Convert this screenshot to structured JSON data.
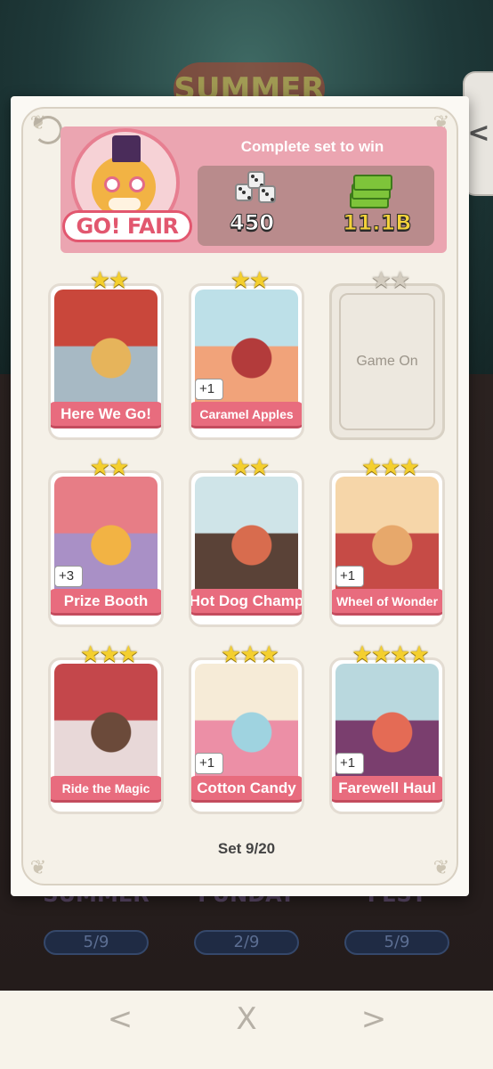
{
  "background": {
    "event_logo": "SUMMER",
    "collections": [
      {
        "title": "SUMMER",
        "progress": "5/9"
      },
      {
        "title": "FUNDAY",
        "progress": "2/9"
      },
      {
        "title": "FEST",
        "progress": "5/9"
      }
    ]
  },
  "set": {
    "logo_text": "GO! FAIR",
    "reward_title": "Complete set to win",
    "reward_dice": "450",
    "reward_cash": "11.1B",
    "counter": "Set 9/20"
  },
  "cards": [
    {
      "name": "Here We Go!",
      "stars": 2,
      "owned": true,
      "extra": "",
      "colors": [
        "#c9473b",
        "#a7b9c4",
        "#e6b45b"
      ]
    },
    {
      "name": "Caramel Apples",
      "stars": 2,
      "owned": true,
      "extra": "+1",
      "colors": [
        "#bde0e8",
        "#f1a37a",
        "#b33b3b"
      ]
    },
    {
      "name": "Game On",
      "stars": 2,
      "owned": false,
      "extra": "",
      "colors": [
        "#ede8df",
        "#ede8df",
        "#ede8df"
      ]
    },
    {
      "name": "Prize Booth",
      "stars": 2,
      "owned": true,
      "extra": "+3",
      "colors": [
        "#e77d86",
        "#a990c6",
        "#f2b344"
      ]
    },
    {
      "name": "Hot Dog Champ",
      "stars": 2,
      "owned": true,
      "extra": "",
      "colors": [
        "#cfe4e8",
        "#5a4237",
        "#d86c4e"
      ]
    },
    {
      "name": "Wheel of Wonder",
      "stars": 3,
      "owned": true,
      "extra": "+1",
      "colors": [
        "#f6d6a9",
        "#c64b46",
        "#e7a86b"
      ]
    },
    {
      "name": "Ride the Magic",
      "stars": 3,
      "owned": true,
      "extra": "",
      "colors": [
        "#c4474b",
        "#e8d8d8",
        "#6b4a3a"
      ]
    },
    {
      "name": "Cotton Candy",
      "stars": 3,
      "owned": true,
      "extra": "+1",
      "colors": [
        "#f6ebd7",
        "#ec8fa6",
        "#9fd3e0"
      ]
    },
    {
      "name": "Farewell Haul",
      "stars": 4,
      "owned": true,
      "extra": "+1",
      "colors": [
        "#b9d8de",
        "#7a3e6e",
        "#e46b55"
      ]
    }
  ],
  "nav": {
    "prev": "<",
    "close": "X",
    "next": ">"
  },
  "side_tab": {
    "label": "<"
  }
}
